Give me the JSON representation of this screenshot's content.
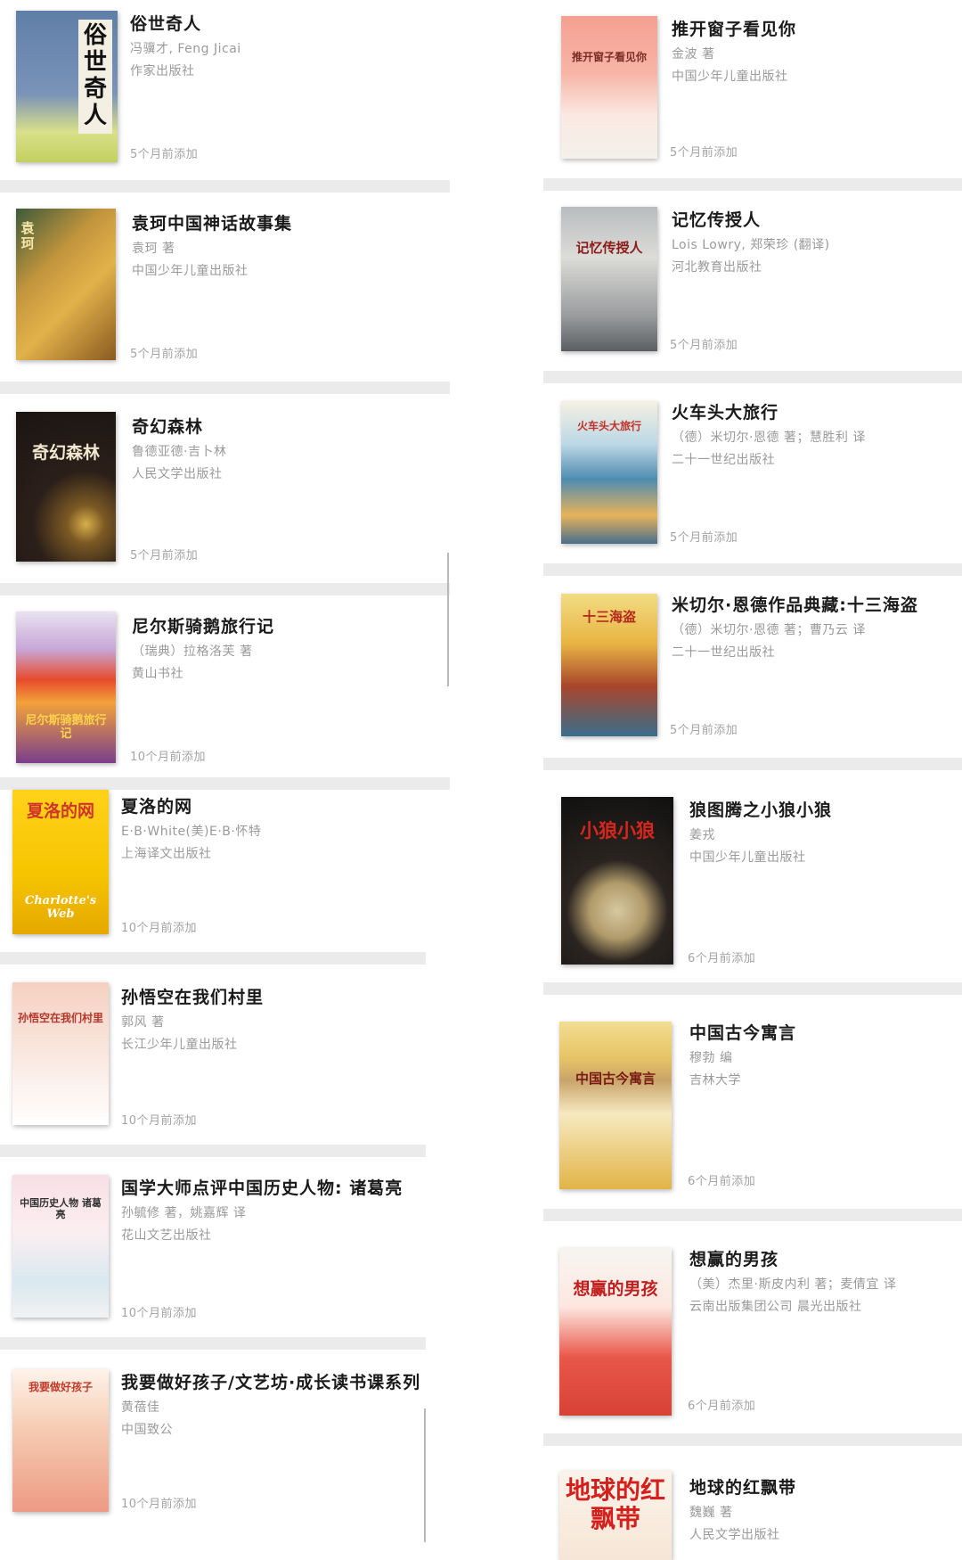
{
  "left_books": [
    {
      "title": "俗世奇人",
      "author": "冯骥才, Feng Jicai",
      "publisher": "作家出版社",
      "added": "5个月前添加",
      "cover_icon": "sushiqiren-cover"
    },
    {
      "title": "袁珂中国神话故事集",
      "author": "袁珂 著",
      "publisher": "中国少年儿童出版社",
      "added": "5个月前添加",
      "cover_icon": "yuanke-myths-cover"
    },
    {
      "title": "奇幻森林",
      "author": "鲁德亚德·吉卜林",
      "publisher": "人民文学出版社",
      "added": "5个月前添加",
      "cover_icon": "jungle-book-cover"
    },
    {
      "title": "尼尔斯骑鹅旅行记",
      "author": "（瑞典）拉格洛芙 著",
      "publisher": "黄山书社",
      "added": "10个月前添加",
      "cover_icon": "nils-cover"
    },
    {
      "title": "夏洛的网",
      "author": "E·B·White(美)E·B·怀特",
      "publisher": "上海译文出版社",
      "added": "10个月前添加",
      "cover_icon": "charlottes-web-cover"
    },
    {
      "title": "孙悟空在我们村里",
      "author": "郭风 著",
      "publisher": "长江少年儿童出版社",
      "added": "10个月前添加",
      "cover_icon": "sunwukong-cover"
    },
    {
      "title": "国学大师点评中国历史人物: 诸葛亮",
      "author": "孙毓修 著，姚嘉辉 译",
      "publisher": "花山文艺出版社",
      "added": "10个月前添加",
      "cover_icon": "zhugeliang-cover"
    },
    {
      "title": "我要做好孩子/文艺坊·成长读书课系列",
      "author": "黄蓓佳",
      "publisher": "中国致公",
      "added": "10个月前添加",
      "cover_icon": "good-kid-cover"
    }
  ],
  "right_books": [
    {
      "title": "推开窗子看见你",
      "author": "金波 著",
      "publisher": "中国少年儿童出版社",
      "added": "5个月前添加",
      "cover_icon": "window-cover"
    },
    {
      "title": "记忆传授人",
      "author": "Lois Lowry, 郑荣珍 (翻译)",
      "publisher": "河北教育出版社",
      "added": "5个月前添加",
      "cover_icon": "giver-cover"
    },
    {
      "title": "火车头大旅行",
      "author": "（德）米切尔·恩德 著；慧胜利 译",
      "publisher": "二十一世纪出版社",
      "added": "5个月前添加",
      "cover_icon": "locomotive-cover"
    },
    {
      "title": "米切尔·恩德作品典藏:十三海盗",
      "author": "（德）米切尔·恩德 著；曹乃云 译",
      "publisher": "二十一世纪出版社",
      "added": "5个月前添加",
      "cover_icon": "thirteen-pirates-cover"
    },
    {
      "title": "狼图腾之小狼小狼",
      "author": "姜戎",
      "publisher": "中国少年儿童出版社",
      "added": "6个月前添加",
      "cover_icon": "little-wolf-cover"
    },
    {
      "title": "中国古今寓言",
      "author": "穆勃 编",
      "publisher": "吉林大学",
      "added": "6个月前添加",
      "cover_icon": "fables-cover"
    },
    {
      "title": "想赢的男孩",
      "author": "（美）杰里·斯皮内利 著；麦倩宜 译",
      "publisher": "云南出版集团公司 晨光出版社",
      "added": "6个月前添加",
      "cover_icon": "boy-who-wants-to-win-cover"
    },
    {
      "title": "地球的红飘带",
      "author": "魏巍 著",
      "publisher": "人民文学出版社",
      "added": "",
      "cover_icon": "red-ribbon-cover"
    }
  ],
  "cover_text": {
    "c0": "俗世奇人",
    "c1": "袁珂",
    "c2": "奇幻森林",
    "c3": "尼尔斯骑鹅旅行记",
    "c4a": "夏洛的网",
    "c4b": "Charlotte's Web",
    "c5": "孙悟空在我们村里",
    "c6": "中国历史人物 诸葛亮",
    "c7": "我要做好孩子",
    "r0": "推开窗子看见你",
    "r1": "记忆传授人",
    "r2": "火车头大旅行",
    "r3": "十三海盗",
    "r4": "小狼小狼",
    "r5": "中国古今寓言",
    "r6": "想赢的男孩",
    "r7": "地球的红飘带"
  }
}
